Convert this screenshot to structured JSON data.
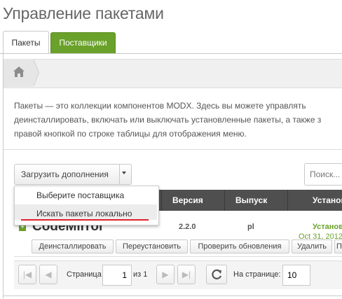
{
  "page": {
    "title": "Управление пакетами"
  },
  "tabs": [
    {
      "label": "Пакеты",
      "active": true
    },
    {
      "label": "Поставщики",
      "active": false,
      "color": "#6aa12a"
    }
  ],
  "breadcrumb": {
    "icon": "home-icon"
  },
  "description": {
    "lines": [
      "Пакеты — это коллекции компонентов MODX. Здесь вы можете управлять",
      "деинсталлировать, включать или выключать установленные пакеты, а также з",
      "правой кнопкой по строке таблицы для отображения меню."
    ]
  },
  "toolbar": {
    "upload_label": "Загрузить дополнения",
    "search_placeholder": "Поиск..."
  },
  "dropdown": {
    "items": [
      "Выберите поставщика",
      "Искать пакеты локально"
    ],
    "highlighted_index": 1
  },
  "grid": {
    "columns": [
      "Версия",
      "Выпуск",
      "Установ"
    ],
    "row": {
      "name": "CodeMirror",
      "version": "2.2.0",
      "release": "pl",
      "installed": "Установ",
      "date": "Oct 31, 2012",
      "actions": [
        "Деинсталлировать",
        "Переустановить",
        "Проверить обновления",
        "Удалить",
        "П"
      ]
    }
  },
  "pager": {
    "page_label": "Страница",
    "page_value": "1",
    "of_label": "из 1",
    "per_page_label": "На странице:",
    "per_page_value": "10"
  },
  "colors": {
    "accent_green": "#6aa12a",
    "header_dark": "#4f4f4f",
    "highlight_red": "#e0202a"
  }
}
